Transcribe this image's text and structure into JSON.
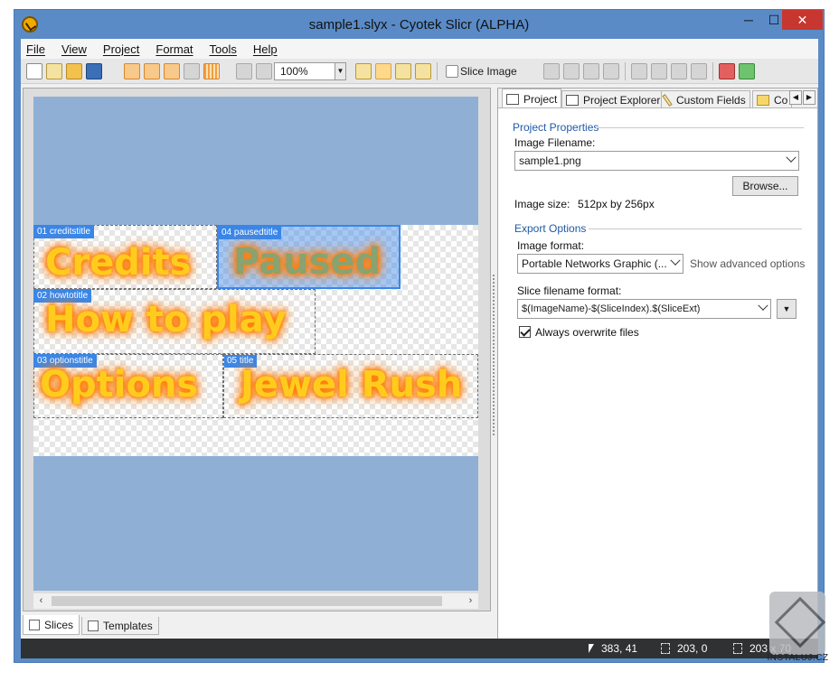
{
  "window": {
    "title": "sample1.slyx - Cyotek Slicr  (ALPHA)",
    "controls": {
      "minimize": "─",
      "maximize": "☐",
      "close": "✕"
    }
  },
  "menu": [
    "File",
    "View",
    "Project",
    "Format",
    "Tools",
    "Help"
  ],
  "toolbar": {
    "zoom_value": "100%",
    "slice_image_label": "Slice Image"
  },
  "canvas": {
    "slices": [
      {
        "tag": "01 creditstitle",
        "text": "Credits",
        "selected": false
      },
      {
        "tag": "04 pausedtitle",
        "text": "Paused",
        "selected": true
      },
      {
        "tag": "02 howtotitle",
        "text": "How to play",
        "selected": false
      },
      {
        "tag": "03 optionstitle",
        "text": "Options",
        "selected": false
      },
      {
        "tag": "05 title",
        "text": "Jewel Rush",
        "selected": false
      }
    ]
  },
  "bottom_tabs": [
    "Slices",
    "Templates"
  ],
  "right_panel": {
    "tabs": [
      "Project",
      "Project Explorer",
      "Custom Fields",
      "Co"
    ],
    "project_properties": {
      "heading": "Project Properties",
      "image_filename_label": "Image Filename:",
      "image_filename_value": "sample1.png",
      "browse_label": "Browse...",
      "image_size_label": "Image size:",
      "image_size_value": "512px by 256px"
    },
    "export_options": {
      "heading": "Export Options",
      "image_format_label": "Image format:",
      "image_format_value": "Portable Networks Graphic (...",
      "advanced_label": "Show advanced options",
      "slice_format_label": "Slice filename format:",
      "slice_format_value": "$(ImageName)-$(SliceIndex).$(SliceExt)",
      "overwrite_label": "Always overwrite files",
      "overwrite_checked": true
    }
  },
  "status": {
    "cursor_pos": "383, 41",
    "selection_pos": "203, 0",
    "selection_size": "203 x 70"
  },
  "watermark": "INSTALUJ.CZ"
}
